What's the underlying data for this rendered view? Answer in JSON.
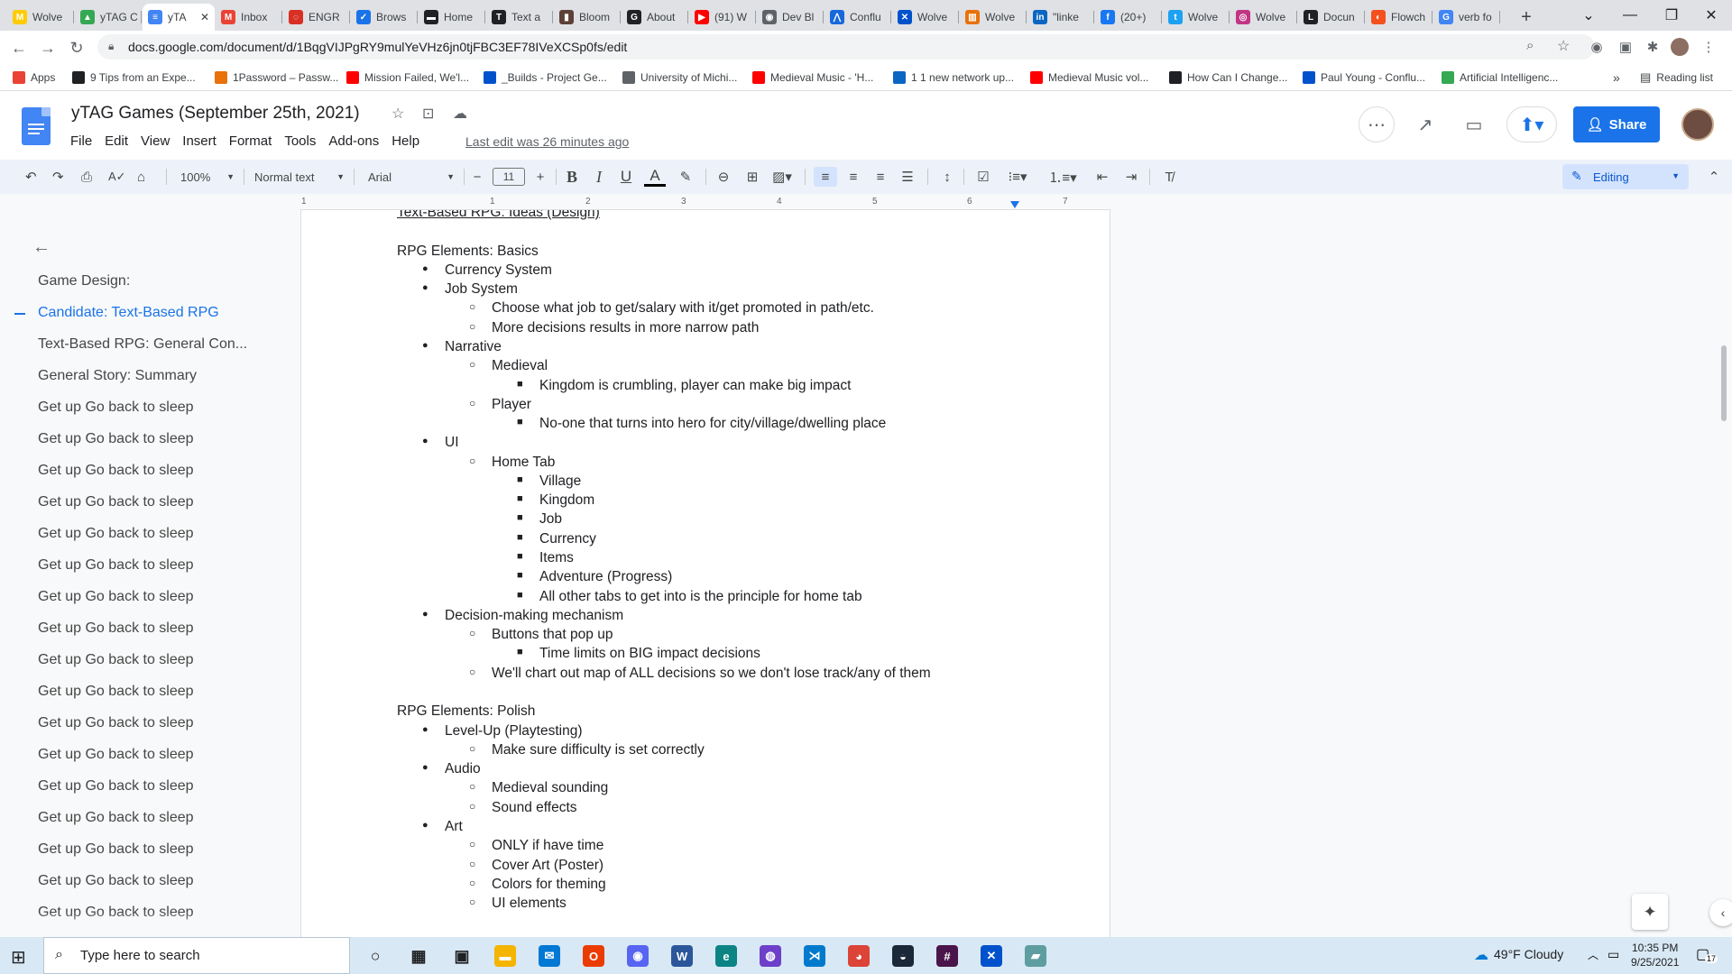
{
  "browser": {
    "tabs": [
      {
        "label": "Wolve",
        "color": "#ffcb05",
        "glyph": "M"
      },
      {
        "label": "yTAG C",
        "color": "#34a853",
        "glyph": "▲"
      },
      {
        "label": "yTA",
        "color": "#4285f4",
        "glyph": "≡",
        "active": true
      },
      {
        "label": "Inbox",
        "color": "#ea4335",
        "glyph": "M"
      },
      {
        "label": "ENGR",
        "color": "#d93025",
        "glyph": "◌"
      },
      {
        "label": "Brows",
        "color": "#1a73e8",
        "glyph": "✓"
      },
      {
        "label": "Home",
        "color": "#202124",
        "glyph": "▬"
      },
      {
        "label": "Text a",
        "color": "#202124",
        "glyph": "T"
      },
      {
        "label": "Bloom",
        "color": "#5d4037",
        "glyph": "▮"
      },
      {
        "label": "About",
        "color": "#202124",
        "glyph": "G"
      },
      {
        "label": "(91) W",
        "color": "#ff0000",
        "glyph": "▶"
      },
      {
        "label": "Dev Bl",
        "color": "#5f6368",
        "glyph": "◉"
      },
      {
        "label": "Conflu",
        "color": "#1868db",
        "glyph": "⋀"
      },
      {
        "label": "Wolve",
        "color": "#0052cc",
        "glyph": "✕"
      },
      {
        "label": "Wolve",
        "color": "#e8710a",
        "glyph": "▥"
      },
      {
        "label": "\"linke",
        "color": "#0a66c2",
        "glyph": "in"
      },
      {
        "label": "(20+)",
        "color": "#1877f2",
        "glyph": "f"
      },
      {
        "label": "Wolve",
        "color": "#1da1f2",
        "glyph": "t"
      },
      {
        "label": "Wolve",
        "color": "#c13584",
        "glyph": "◎"
      },
      {
        "label": "Docun",
        "color": "#202124",
        "glyph": "L"
      },
      {
        "label": "Flowch",
        "color": "#f4511e",
        "glyph": "◐"
      },
      {
        "label": "verb fo",
        "color": "#4285f4",
        "glyph": "G"
      }
    ],
    "new_tab": "+",
    "url": "docs.google.com/document/d/1BqgVIJPgRY9mulYeVHz6jn0tjFBC3EF78IVeXCSp0fs/edit",
    "bookmarks": [
      {
        "label": "Apps",
        "color": "#ea4335"
      },
      {
        "label": "9 Tips from an Expe...",
        "color": "#202124"
      },
      {
        "label": "1Password – Passw...",
        "color": "#e8710a"
      },
      {
        "label": "Mission Failed, We'l...",
        "color": "#ff0000"
      },
      {
        "label": "_Builds - Project Ge...",
        "color": "#0052cc"
      },
      {
        "label": "University of Michi...",
        "color": "#5f6368"
      },
      {
        "label": "Medieval Music - 'H...",
        "color": "#ff0000"
      },
      {
        "label": "1 1 new network up...",
        "color": "#0a66c2"
      },
      {
        "label": "Medieval Music vol...",
        "color": "#ff0000"
      },
      {
        "label": "How Can I Change...",
        "color": "#202124"
      },
      {
        "label": "Paul Young - Conflu...",
        "color": "#0052cc"
      },
      {
        "label": "Artificial Intelligenc...",
        "color": "#34a853"
      }
    ],
    "bookmarks_more": "»",
    "reading_list": "Reading list"
  },
  "doc": {
    "title": "yTAG Games (September 25th, 2021)",
    "menu": [
      "File",
      "Edit",
      "View",
      "Insert",
      "Format",
      "Tools",
      "Add-ons",
      "Help"
    ],
    "last_edit": "Last edit was 26 minutes ago",
    "share_label": "Share",
    "zoom": "100%",
    "style": "Normal text",
    "font": "Arial",
    "font_size": "11",
    "mode": "Editing"
  },
  "ruler_numbers": [
    "1",
    "1",
    "2",
    "3",
    "4",
    "5",
    "6",
    "7"
  ],
  "outline": {
    "items": [
      {
        "label": "Game Design:",
        "active": false
      },
      {
        "label": "Candidate: Text-Based RPG",
        "active": true
      },
      {
        "label": "Text-Based RPG: General Con...",
        "active": false
      },
      {
        "label": "General Story: Summary",
        "active": false
      },
      {
        "label": "Get up Go back to sleep",
        "active": false
      },
      {
        "label": "Get up Go back to sleep",
        "active": false
      },
      {
        "label": "Get up Go back to sleep",
        "active": false
      },
      {
        "label": "Get up Go back to sleep",
        "active": false
      },
      {
        "label": "Get up Go back to sleep",
        "active": false
      },
      {
        "label": "Get up Go back to sleep",
        "active": false
      },
      {
        "label": "Get up Go back to sleep",
        "active": false
      },
      {
        "label": "Get up Go back to sleep",
        "active": false
      },
      {
        "label": "Get up Go back to sleep",
        "active": false
      },
      {
        "label": "Get up Go back to sleep",
        "active": false
      },
      {
        "label": "Get up Go back to sleep",
        "active": false
      },
      {
        "label": "Get up Go back to sleep",
        "active": false
      },
      {
        "label": "Get up Go back to sleep",
        "active": false
      },
      {
        "label": "Get up Go back to sleep",
        "active": false
      },
      {
        "label": "Get up Go back to sleep",
        "active": false
      },
      {
        "label": "Get up Go back to sleep",
        "active": false
      },
      {
        "label": "Get up Go back to sleep",
        "active": false
      }
    ]
  },
  "content": [
    {
      "text": "Text-Based RPG: Ideas (Design)",
      "level": 0,
      "underline": true
    },
    {
      "text": "",
      "level": 0
    },
    {
      "text": "RPG Elements: Basics",
      "level": 0
    },
    {
      "text": "Currency System",
      "level": 1
    },
    {
      "text": "Job System",
      "level": 1
    },
    {
      "text": "Choose what job to get/salary with it/get promoted in path/etc.",
      "level": 2
    },
    {
      "text": "More decisions results in more narrow path",
      "level": 2
    },
    {
      "text": "Narrative",
      "level": 1
    },
    {
      "text": "Medieval",
      "level": 2
    },
    {
      "text": "Kingdom is crumbling, player can make big impact",
      "level": 3
    },
    {
      "text": "Player",
      "level": 2
    },
    {
      "text": "No-one that turns into hero for city/village/dwelling place",
      "level": 3
    },
    {
      "text": "UI",
      "level": 1
    },
    {
      "text": "Home Tab",
      "level": 2
    },
    {
      "text": "Village",
      "level": 3
    },
    {
      "text": "Kingdom",
      "level": 3
    },
    {
      "text": "Job",
      "level": 3
    },
    {
      "text": "Currency",
      "level": 3
    },
    {
      "text": "Items",
      "level": 3
    },
    {
      "text": "Adventure (Progress)",
      "level": 3
    },
    {
      "text": "All other tabs to get into is the principle for home tab",
      "level": 3
    },
    {
      "text": "Decision-making mechanism",
      "level": 1
    },
    {
      "text": "Buttons that pop up",
      "level": 2
    },
    {
      "text": "Time limits on BIG impact decisions",
      "level": 3
    },
    {
      "text": "We'll chart out map of ALL decisions so we don't lose track/any of them",
      "level": 2
    },
    {
      "text": "",
      "level": 0
    },
    {
      "text": "RPG Elements: Polish",
      "level": 0
    },
    {
      "text": "Level-Up (Playtesting)",
      "level": 1
    },
    {
      "text": "Make sure difficulty is set correctly",
      "level": 2
    },
    {
      "text": "Audio",
      "level": 1
    },
    {
      "text": "Medieval sounding",
      "level": 2
    },
    {
      "text": "Sound effects",
      "level": 2
    },
    {
      "text": "Art",
      "level": 1
    },
    {
      "text": "ONLY if have time",
      "level": 2
    },
    {
      "text": "Cover Art (Poster)",
      "level": 2
    },
    {
      "text": "Colors for theming",
      "level": 2
    },
    {
      "text": "UI elements",
      "level": 2
    }
  ],
  "taskbar": {
    "search_placeholder": "Type here to search",
    "apps": [
      {
        "name": "task-view",
        "color": "#202124",
        "glyph": "○"
      },
      {
        "name": "widgets",
        "color": "#202124",
        "glyph": "▦"
      },
      {
        "name": "store",
        "color": "#202124",
        "glyph": "▣"
      },
      {
        "name": "file-explorer",
        "color": "#f4b400",
        "glyph": "▬"
      },
      {
        "name": "mail",
        "color": "#0078d4",
        "glyph": "✉"
      },
      {
        "name": "office",
        "color": "#eb3c00",
        "glyph": "O"
      },
      {
        "name": "discord",
        "color": "#5865f2",
        "glyph": "◉"
      },
      {
        "name": "word",
        "color": "#2b579a",
        "glyph": "W"
      },
      {
        "name": "edge",
        "color": "#0c8484",
        "glyph": "e"
      },
      {
        "name": "github",
        "color": "#6e40c9",
        "glyph": "◍"
      },
      {
        "name": "vscode",
        "color": "#007acc",
        "glyph": "⋊"
      },
      {
        "name": "chrome",
        "color": "#db4437",
        "glyph": "◕"
      },
      {
        "name": "steam",
        "color": "#1b2838",
        "glyph": "◒"
      },
      {
        "name": "slack",
        "color": "#4a154b",
        "glyph": "#"
      },
      {
        "name": "jira",
        "color": "#0052cc",
        "glyph": "✕"
      },
      {
        "name": "notes",
        "color": "#5f9ea0",
        "glyph": "▰"
      }
    ],
    "weather": "49°F  Cloudy",
    "time": "10:35 PM",
    "date": "9/25/2021",
    "notification_count": "17"
  }
}
